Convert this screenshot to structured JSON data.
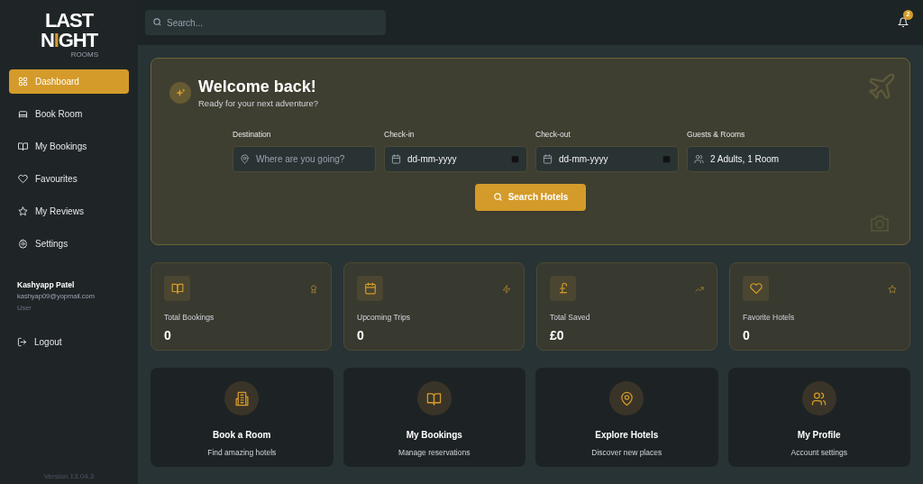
{
  "logo": {
    "line1": "LAST",
    "line2": [
      "N",
      "I",
      "GHT"
    ],
    "tagline": "ROOMS"
  },
  "sidebar": {
    "items": [
      {
        "label": "Dashboard",
        "selected": true
      },
      {
        "label": "Book Room",
        "selected": false
      },
      {
        "label": "My Bookings",
        "selected": false
      },
      {
        "label": "Favourites",
        "selected": false
      },
      {
        "label": "My Reviews",
        "selected": false
      },
      {
        "label": "Settings",
        "selected": false
      }
    ],
    "user": {
      "name": "Kashyapp Patel",
      "email": "kashyap09@yopmail.com",
      "role": "User"
    },
    "logout": "Logout",
    "version": "Version 13.04.3"
  },
  "header": {
    "search": {
      "placeholder": "Search..."
    },
    "notifications": "2"
  },
  "welcome": {
    "title": "Welcome back!",
    "subtitle": "Ready for your next adventure?",
    "fields": [
      {
        "label": "Destination",
        "placeholder": "Where are you going?"
      },
      {
        "label": "Check-in",
        "value": "dd-mm-yyyy"
      },
      {
        "label": "Check-out",
        "value": "dd-mm-yyyy"
      },
      {
        "label": "Guests & Rooms",
        "value": "2 Adults, 1 Room"
      }
    ],
    "button": "Search Hotels"
  },
  "stats": [
    {
      "label": "Total Bookings",
      "value": "0"
    },
    {
      "label": "Upcoming Trips",
      "value": "0"
    },
    {
      "label": "Total Saved",
      "value": "£0"
    },
    {
      "label": "Favorite Hotels",
      "value": "0"
    }
  ],
  "actions": [
    {
      "title": "Book a Room",
      "subtitle": "Find amazing hotels"
    },
    {
      "title": "My Bookings",
      "subtitle": "Manage reservations"
    },
    {
      "title": "Explore Hotels",
      "subtitle": "Discover new places"
    },
    {
      "title": "My Profile",
      "subtitle": "Account settings"
    }
  ]
}
